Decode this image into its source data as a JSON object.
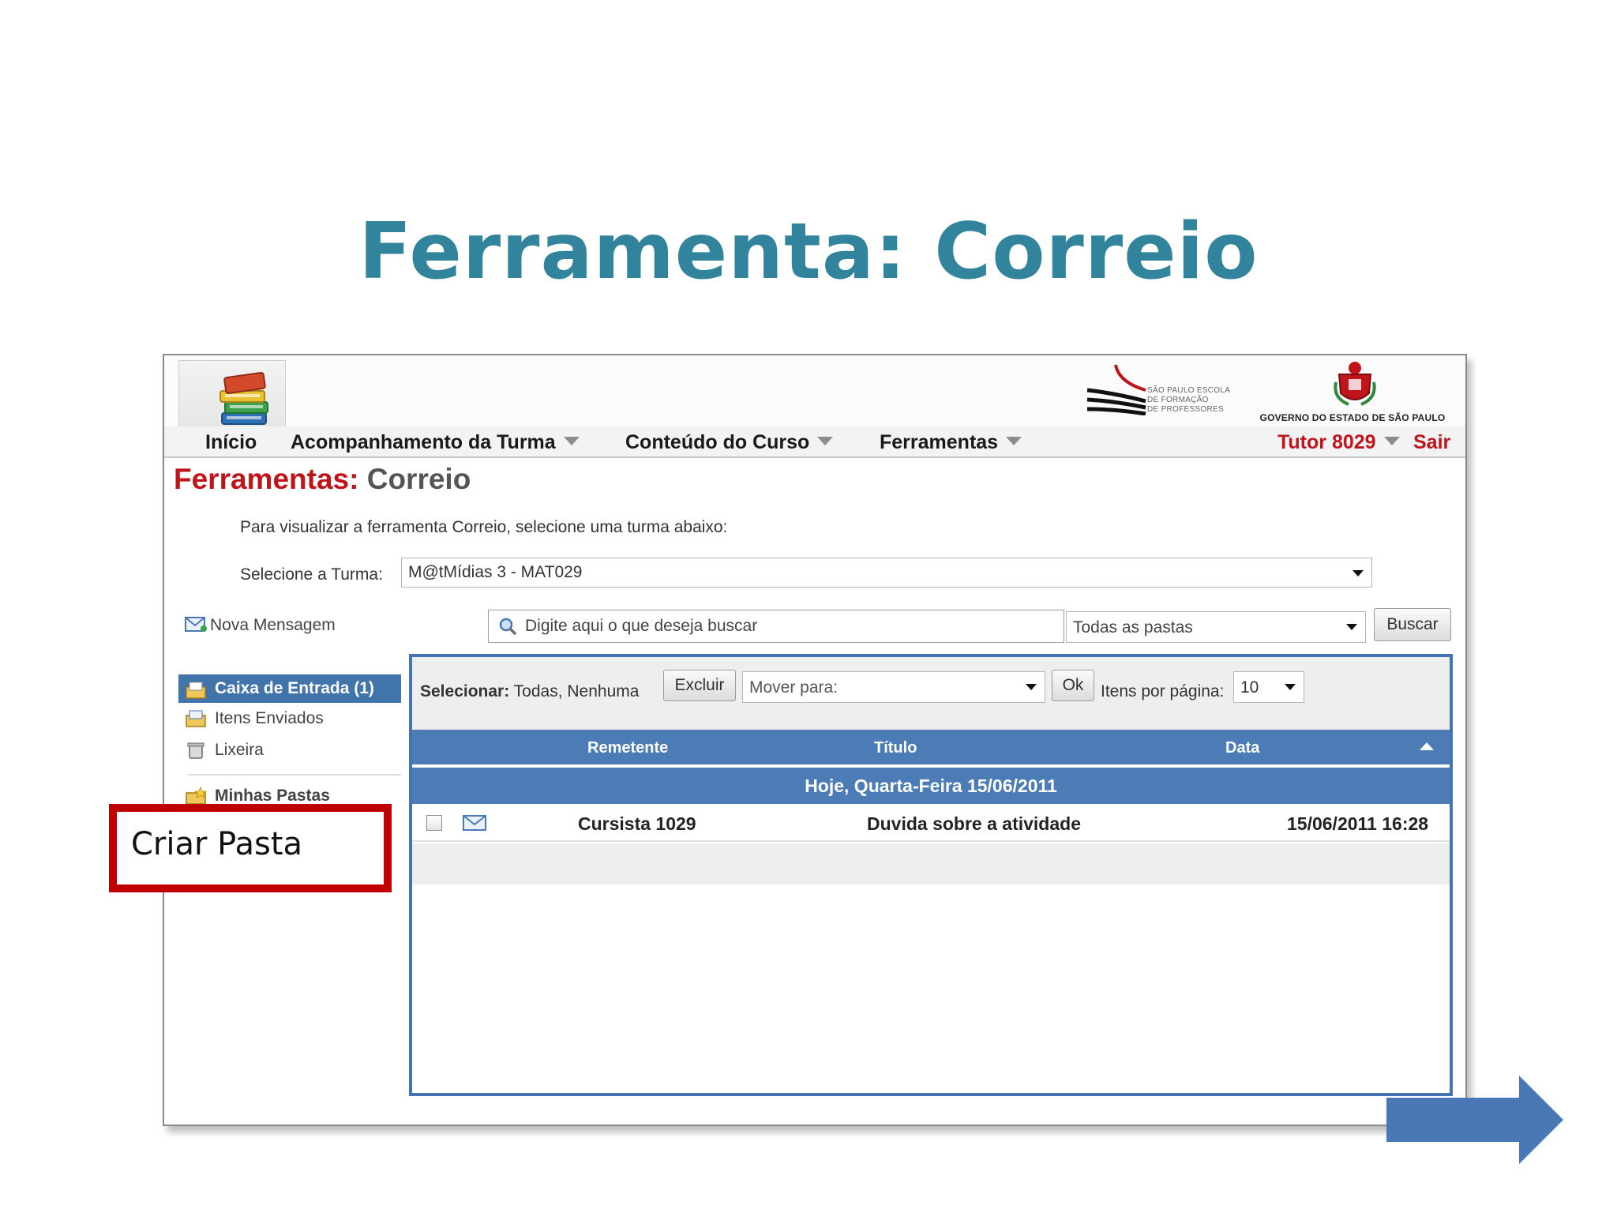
{
  "slide": {
    "title": "Ferramenta: Correio"
  },
  "menu": {
    "inicio": "Início",
    "acompanhamento": "Acompanhamento da Turma",
    "conteudo": "Conteúdo do Curso",
    "ferramentas": "Ferramentas",
    "user": "Tutor 8029",
    "sair": "Sair"
  },
  "logos": {
    "spfp_lines": [
      "SÃO PAULO ESCOLA",
      "DE FORMAÇÃO",
      "DE PROFESSORES"
    ],
    "gov": "GOVERNO DO ESTADO DE SÃO PAULO"
  },
  "page": {
    "heading_prefix": "Ferramentas:",
    "heading_suffix": " Correio",
    "instruction": "Para visualizar a ferramenta Correio, selecione uma turma abaixo:",
    "turma_label": "Selecione a Turma:",
    "turma_value": "M@tMídias 3 - MAT029"
  },
  "search": {
    "nova_mensagem": "Nova Mensagem",
    "placeholder": "Digite aqui o que deseja buscar",
    "folder_value": "Todas as pastas",
    "buscar": "Buscar"
  },
  "sidebar": {
    "items": [
      {
        "label": "Caixa de Entrada (1)",
        "icon": "inbox-icon"
      },
      {
        "label": "Itens Enviados",
        "icon": "sent-items-icon"
      },
      {
        "label": "Lixeira",
        "icon": "trash-icon"
      }
    ],
    "minhas_pastas": "Minhas Pastas"
  },
  "toolbar": {
    "selecionar_label": "Selecionar:",
    "selecionar_options": " Todas, Nenhuma",
    "excluir": "Excluir",
    "mover_para": "Mover para:",
    "ok": "Ok",
    "itens_por_pagina": "Itens por página:",
    "per_page_value": "10"
  },
  "table": {
    "headers": {
      "remetente": "Remetente",
      "titulo": "Título",
      "data": "Data"
    },
    "group": "Hoje, Quarta-Feira 15/06/2011",
    "rows": [
      {
        "remetente": "Cursista 1029",
        "titulo": "Duvida sobre a atividade",
        "data": "15/06/2011 16:28"
      }
    ]
  },
  "callout": {
    "text": "Criar Pasta"
  },
  "colors": {
    "title": "#31849b",
    "accent_blue": "#4b7cb6",
    "brand_red": "#c0141b",
    "callout_red": "#c00000",
    "arrow": "#4a78b7"
  }
}
